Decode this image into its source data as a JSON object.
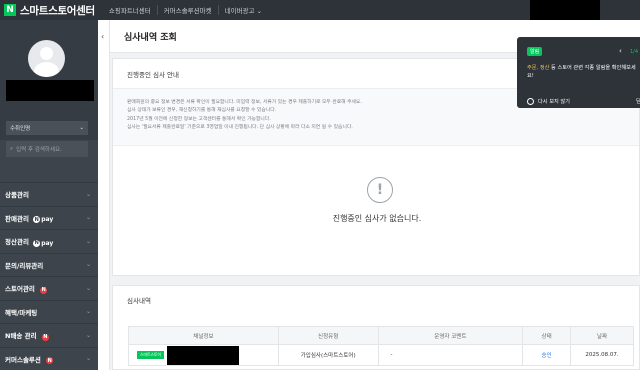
{
  "topbar": {
    "logo_mark": "N",
    "title": "스마트스토어센터",
    "links": [
      "쇼핑파트너센터",
      "커머스솔루션마켓",
      "네이버광고 ⌄"
    ]
  },
  "sidebar": {
    "store_select": "수취인명",
    "search_placeholder": "입력 후 검색하세요.",
    "menu": [
      {
        "label": "상품관리",
        "pay": "",
        "badge": ""
      },
      {
        "label": "판매관리",
        "pay": "pay",
        "badge": ""
      },
      {
        "label": "정산관리",
        "pay": "pay",
        "badge": ""
      },
      {
        "label": "문의/리뷰관리",
        "pay": "",
        "badge": ""
      },
      {
        "label": "스토어관리",
        "pay": "",
        "badge": "N"
      },
      {
        "label": "혜택/마케팅",
        "pay": "",
        "badge": ""
      },
      {
        "label": "N배송 관리",
        "pay": "",
        "badge": "N"
      },
      {
        "label": "커머스솔루션",
        "pay": "",
        "badge": "N"
      }
    ]
  },
  "page": {
    "title": "심사내역 조회",
    "collapse": "‹"
  },
  "inprogress": {
    "heading": "진행중인 심사 안내",
    "notices": [
      "판매회원의 중요 정보 변경은 서류 확인이 필요합니다. 미입력 정보, 서류가 있는 경우 제출하기로 모두 완료해 주세요.",
      "심사 상태가 보류인 경우, 재신청하기를 통해 재심사를 요청할 수 있습니다.",
      "2017년 5월 이전에 신청한 정보는 고객센터를 통해서 확인 가능합니다.",
      "심사는 '필요서류 제출완료일' 기준으로 3영업일 이내 진행됩니다. 단 심사 상황에 따라 다소 지연 될 수 있습니다."
    ],
    "empty_icon": "!",
    "empty_text": "진행중인 심사가 없습니다."
  },
  "history": {
    "heading": "심사내역",
    "columns": [
      "채널정보",
      "신청유형",
      "운영자 코멘트",
      "상태",
      "날짜"
    ],
    "rows": [
      {
        "channel_badge": "스마트스토어",
        "type": "가입심사(스마트스토어)",
        "comment": "-",
        "status": "승인",
        "date": "2025.08.07."
      }
    ]
  },
  "popup": {
    "badge": "알림",
    "nav": "‹",
    "page": "1/4",
    "text_hl": "주문, 정산",
    "text_rest": " 등 스토어 관련 각종 알림을 확인해보세요!",
    "dont_show": "다시 보지 않기",
    "close": "닫"
  },
  "colors": {
    "accent": "#03c75a",
    "sidebar": "#3d444c",
    "topbar": "#2d3339",
    "link": "#1a73e8"
  }
}
